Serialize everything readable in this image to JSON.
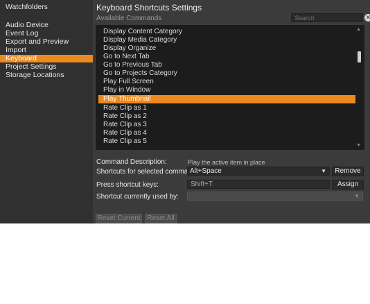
{
  "sidebar": {
    "items": [
      {
        "label": "Watchfolders",
        "active": false
      },
      {
        "label": "Audio Device",
        "active": false
      },
      {
        "label": "Event Log",
        "active": false
      },
      {
        "label": "Export and Preview",
        "active": false
      },
      {
        "label": "Import",
        "active": false
      },
      {
        "label": "Keyboard",
        "active": true
      },
      {
        "label": "Project Settings",
        "active": false
      },
      {
        "label": "Storage Locations",
        "active": false
      }
    ]
  },
  "main": {
    "title": "Keyboard Shortcuts Settings",
    "available_label": "Available Commands",
    "search": {
      "placeholder": "Search",
      "clear_icon": "close-circle-icon"
    },
    "commands": [
      "Display Content Category",
      "Display Media Category",
      "Display Organize",
      "Go to Next Tab",
      "Go to Previous Tab",
      "Go to Projects Category",
      "Play Full Screen",
      "Play in Window",
      "Play Thumbnail",
      "Rate Clip as 1",
      "Rate Clip as 2",
      "Rate Clip as 3",
      "Rate Clip as 4",
      "Rate Clip as 5"
    ],
    "selected_command": "Play Thumbnail",
    "form": {
      "description_label": "Command Description:",
      "description_value": "Play the active item in place",
      "shortcuts_label": "Shortcuts for selected command:",
      "shortcuts_value": "Alt+Space",
      "remove_label": "Remove",
      "press_label": "Press shortcut keys:",
      "press_value": "Shift+T",
      "assign_label": "Assign",
      "used_by_label": "Shortcut currently used by:",
      "used_by_value": ""
    },
    "reset_current_label": "Reset Current",
    "reset_all_label": "Reset All"
  },
  "colors": {
    "accent": "#ec8a1f",
    "panel": "#3b3b3b",
    "sidebar": "#303030",
    "list": "#1c1c1c"
  }
}
